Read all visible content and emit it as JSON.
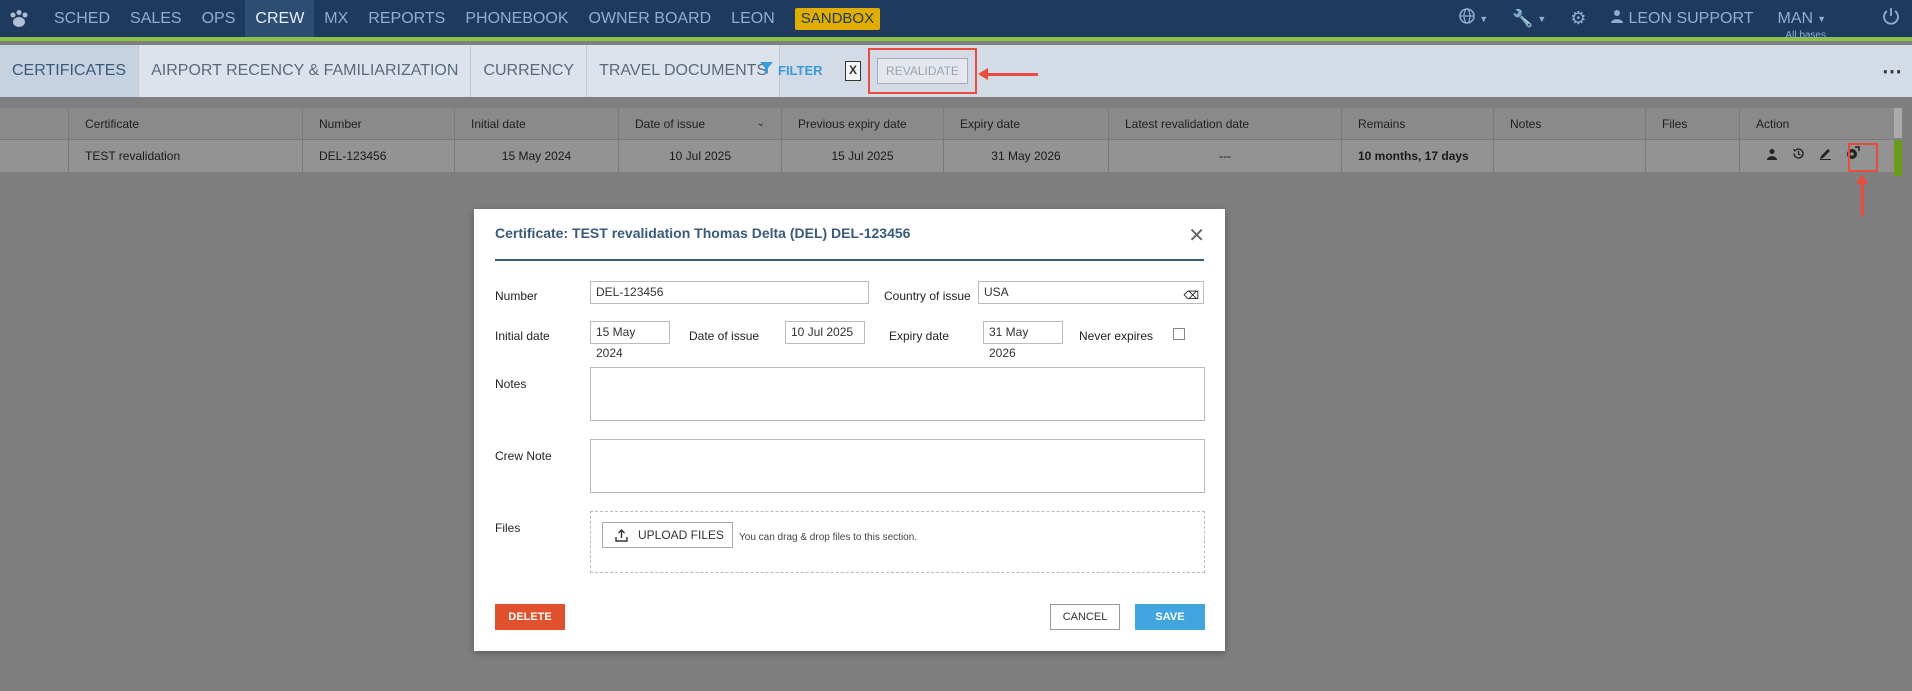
{
  "nav": {
    "items": [
      "SCHED",
      "SALES",
      "OPS",
      "CREW",
      "MX",
      "REPORTS",
      "PHONEBOOK",
      "OWNER BOARD",
      "LEON"
    ],
    "active": "CREW",
    "sandbox": "SANDBOX",
    "user": "LEON SUPPORT",
    "base": "MAN",
    "base_sub": "All bases"
  },
  "subtabs": {
    "items": [
      "CERTIFICATES",
      "AIRPORT RECENCY & FAMILIARIZATION",
      "CURRENCY",
      "TRAVEL DOCUMENTS"
    ],
    "filter": "FILTER",
    "excel": "X",
    "revalidate": "REVALIDATE"
  },
  "table": {
    "headers": [
      "Certificate",
      "Number",
      "Initial date",
      "Date of issue",
      "Previous expiry date",
      "Expiry date",
      "Latest revalidation date",
      "Remains",
      "Notes",
      "Files",
      "Action"
    ],
    "row": {
      "certificate": "TEST revalidation",
      "number": "DEL-123456",
      "initial_date": "15 May 2024",
      "date_of_issue": "10 Jul 2025",
      "previous_expiry": "15 Jul 2025",
      "expiry_date": "31 May 2026",
      "latest_revalidation": "---",
      "remains": "10 months, 17 days",
      "notes": "",
      "files": ""
    }
  },
  "modal": {
    "title": "Certificate: TEST revalidation Thomas Delta (DEL) DEL-123456",
    "number_label": "Number",
    "number_value": "DEL-123456",
    "country_label": "Country of issue",
    "country_value": "USA",
    "initial_label": "Initial date",
    "initial_value": "15 May 2024",
    "issue_label": "Date of issue",
    "issue_value": "10 Jul 2025",
    "expiry_label": "Expiry date",
    "expiry_value": "31 May 2026",
    "never_expires_label": "Never expires",
    "notes_label": "Notes",
    "crew_note_label": "Crew Note",
    "files_label": "Files",
    "upload_label": "UPLOAD FILES",
    "drag_text": "You can drag & drop files to this section.",
    "delete_label": "DELETE",
    "cancel_label": "CANCEL",
    "save_label": "SAVE"
  },
  "colors": {
    "nav_bg": "#1f3a5f",
    "accent_green": "#8bc34a",
    "sandbox": "#e1ad01",
    "highlight_red": "#e74c3c",
    "save_blue": "#41a6df",
    "delete_orange": "#e0522e"
  }
}
